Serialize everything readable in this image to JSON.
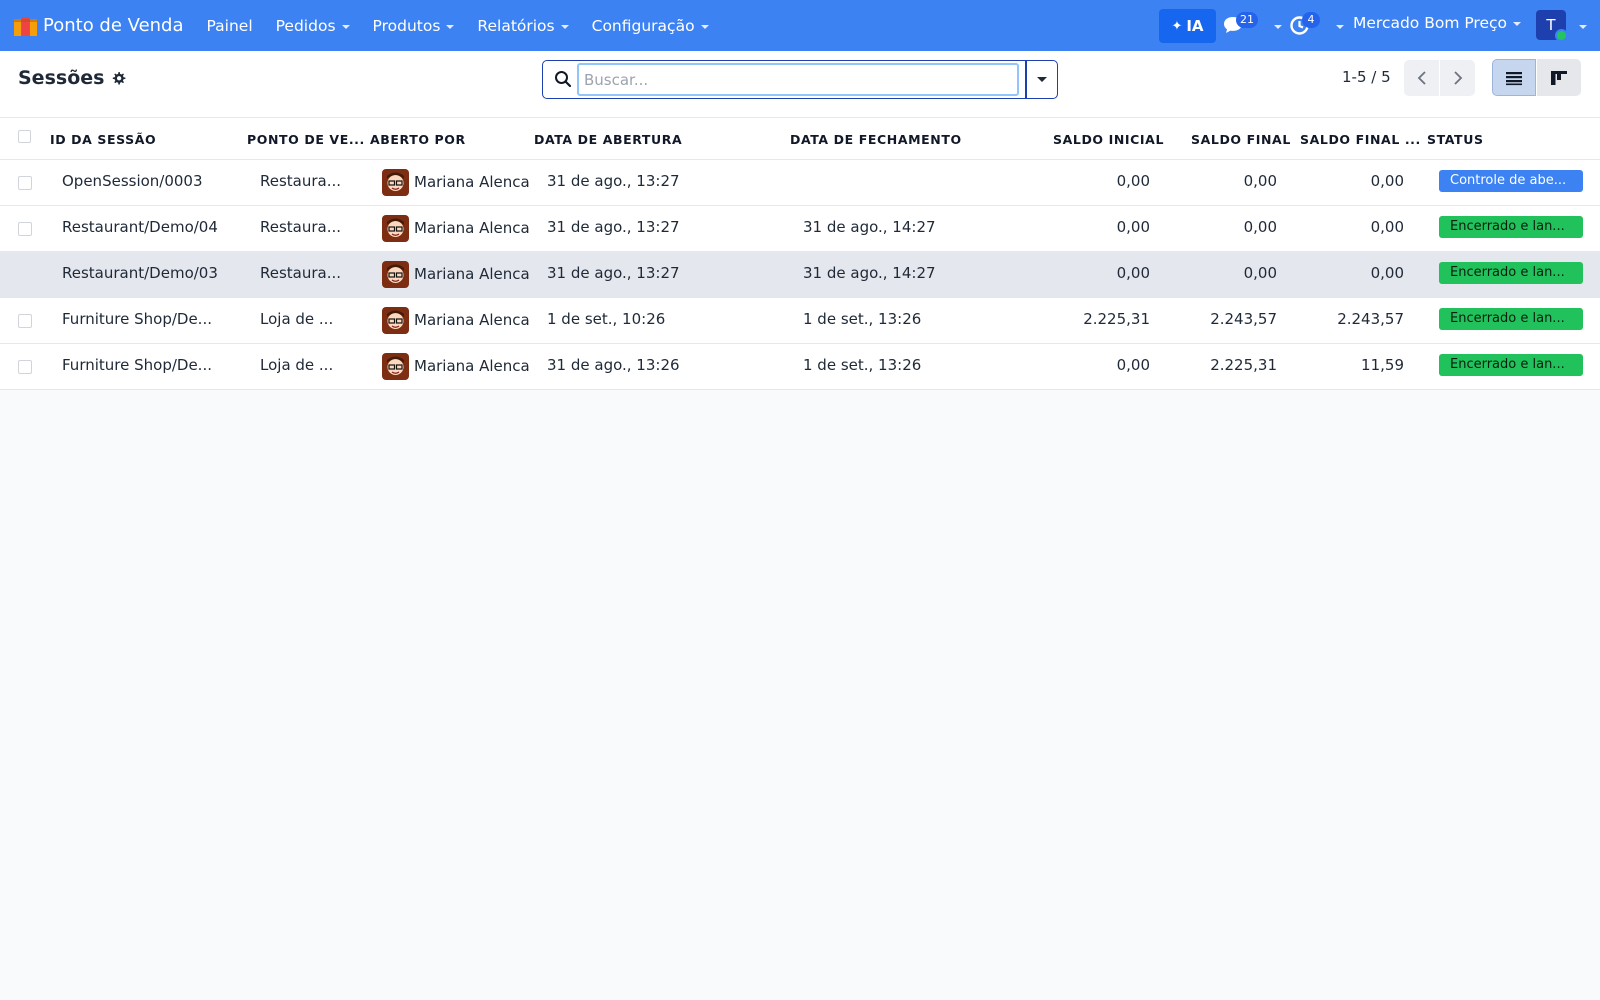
{
  "app": {
    "name": "Ponto de Venda",
    "menu": [
      {
        "label": "Painel",
        "dropdown": false
      },
      {
        "label": "Pedidos",
        "dropdown": true
      },
      {
        "label": "Produtos",
        "dropdown": true
      },
      {
        "label": "Relatórios",
        "dropdown": true
      },
      {
        "label": "Configuração",
        "dropdown": true
      }
    ],
    "ai_label": "IA",
    "messages_count": "21",
    "activities_count": "4",
    "company": "Mercado Bom Preço",
    "user_initial": "T",
    "colors": {
      "navbar": "#3c82f2",
      "accent": "#1766f0",
      "status_open": "#3c82f2",
      "status_closed": "#21c15b"
    }
  },
  "control": {
    "title": "Sessões",
    "search_placeholder": "Buscar...",
    "search_value": "",
    "pager": "1-5 / 5"
  },
  "table": {
    "columns": [
      "ID DA SESSÃO",
      "PONTO DE VE...",
      "ABERTO POR",
      "DATA DE ABERTURA",
      "DATA DE FECHAMENTO",
      "SALDO INICIAL",
      "SALDO FINAL",
      "SALDO FINAL ...",
      "STATUS"
    ],
    "rows": [
      {
        "id": "OpenSession/0003",
        "pos": "Restaura...",
        "opened_by": "Mariana Alencar",
        "opened": "31 de ago., 13:27",
        "closed": "",
        "start": "0,00",
        "end": "0,00",
        "end_real": "0,00",
        "status": "Controle de abe...",
        "status_kind": "open"
      },
      {
        "id": "Restaurant/Demo/04",
        "pos": "Restaura...",
        "opened_by": "Mariana Alencar",
        "opened": "31 de ago., 13:27",
        "closed": "31 de ago., 14:27",
        "start": "0,00",
        "end": "0,00",
        "end_real": "0,00",
        "status": "Encerrado e lan...",
        "status_kind": "closed"
      },
      {
        "id": "Restaurant/Demo/03",
        "pos": "Restaura...",
        "opened_by": "Mariana Alencar",
        "opened": "31 de ago., 13:27",
        "closed": "31 de ago., 14:27",
        "start": "0,00",
        "end": "0,00",
        "end_real": "0,00",
        "status": "Encerrado e lan...",
        "status_kind": "closed"
      },
      {
        "id": "Furniture Shop/De...",
        "pos": "Loja de ...",
        "opened_by": "Mariana Alencar",
        "opened": "1 de set., 10:26",
        "closed": "1 de set., 13:26",
        "start": "2.225,31",
        "end": "2.243,57",
        "end_real": "2.243,57",
        "status": "Encerrado e lan...",
        "status_kind": "closed"
      },
      {
        "id": "Furniture Shop/De...",
        "pos": "Loja de ...",
        "opened_by": "Mariana Alencar",
        "opened": "31 de ago., 13:26",
        "closed": "1 de set., 13:26",
        "start": "0,00",
        "end": "2.225,31",
        "end_real": "11,59",
        "status": "Encerrado e lan...",
        "status_kind": "closed"
      }
    ]
  }
}
